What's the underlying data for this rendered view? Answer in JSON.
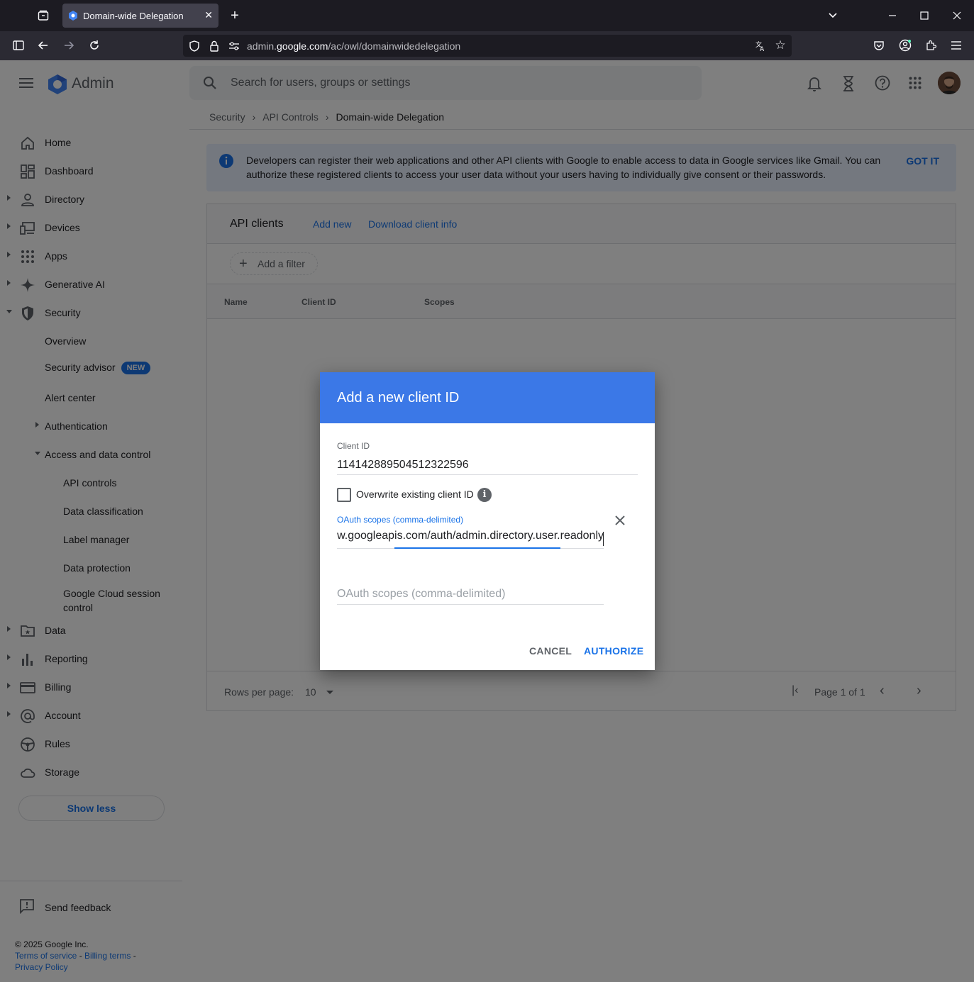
{
  "browser": {
    "tab_title": "Domain-wide Delegation",
    "url_prefix": "admin.",
    "url_host": "google.com",
    "url_path": "/ac/owl/domainwidedelegation"
  },
  "header": {
    "product": "Admin",
    "search_placeholder": "Search for users, groups or settings"
  },
  "breadcrumb": [
    "Security",
    "API Controls",
    "Domain-wide Delegation"
  ],
  "sidebar": {
    "items": [
      {
        "label": "Home"
      },
      {
        "label": "Dashboard"
      },
      {
        "label": "Directory"
      },
      {
        "label": "Devices"
      },
      {
        "label": "Apps"
      },
      {
        "label": "Generative AI"
      },
      {
        "label": "Security"
      },
      {
        "label": "Overview"
      },
      {
        "label": "Security advisor",
        "badge": "NEW"
      },
      {
        "label": "Alert center"
      },
      {
        "label": "Authentication"
      },
      {
        "label": "Access and data control"
      },
      {
        "label": "API controls"
      },
      {
        "label": "Data classification"
      },
      {
        "label": "Label manager"
      },
      {
        "label": "Data protection"
      },
      {
        "label": "Google Cloud session",
        "label2": "control"
      },
      {
        "label": "Data"
      },
      {
        "label": "Reporting"
      },
      {
        "label": "Billing"
      },
      {
        "label": "Account"
      },
      {
        "label": "Rules"
      },
      {
        "label": "Storage"
      }
    ],
    "show_less": "Show less",
    "send_feedback": "Send feedback",
    "copyright": "© 2025 Google Inc.",
    "terms": "Terms of service",
    "billing_terms": "Billing terms",
    "privacy": "Privacy Policy",
    "dash": " - "
  },
  "banner": {
    "text": "Developers can register their web applications and other API clients with Google to enable access to data in Google services like Gmail. You can authorize these registered clients to access your user data without your users having to individually give consent or their passwords.",
    "button": "GOT IT"
  },
  "card": {
    "title": "API clients",
    "add_new": "Add new",
    "download": "Download client info",
    "filter": "Add a filter",
    "columns": [
      "Name",
      "Client ID",
      "Scopes"
    ],
    "rows_per_page_label": "Rows per page:",
    "rows_per_page": "10",
    "page_label": "Page 1 of 1"
  },
  "dialog": {
    "title": "Add a new client ID",
    "client_id_label": "Client ID",
    "client_id": "114142889504512322596",
    "overwrite_label": "Overwrite existing client ID",
    "scopes_label": "OAuth scopes (comma-delimited)",
    "scope_value": "https://www.googleapis.com/auth/admin.directory.user.readonly",
    "scopes_placeholder": "OAuth scopes (comma-delimited)",
    "cancel": "CANCEL",
    "authorize": "AUTHORIZE"
  },
  "colors": {
    "accent": "#1a73e8",
    "dialog_header": "#3b78e7"
  }
}
